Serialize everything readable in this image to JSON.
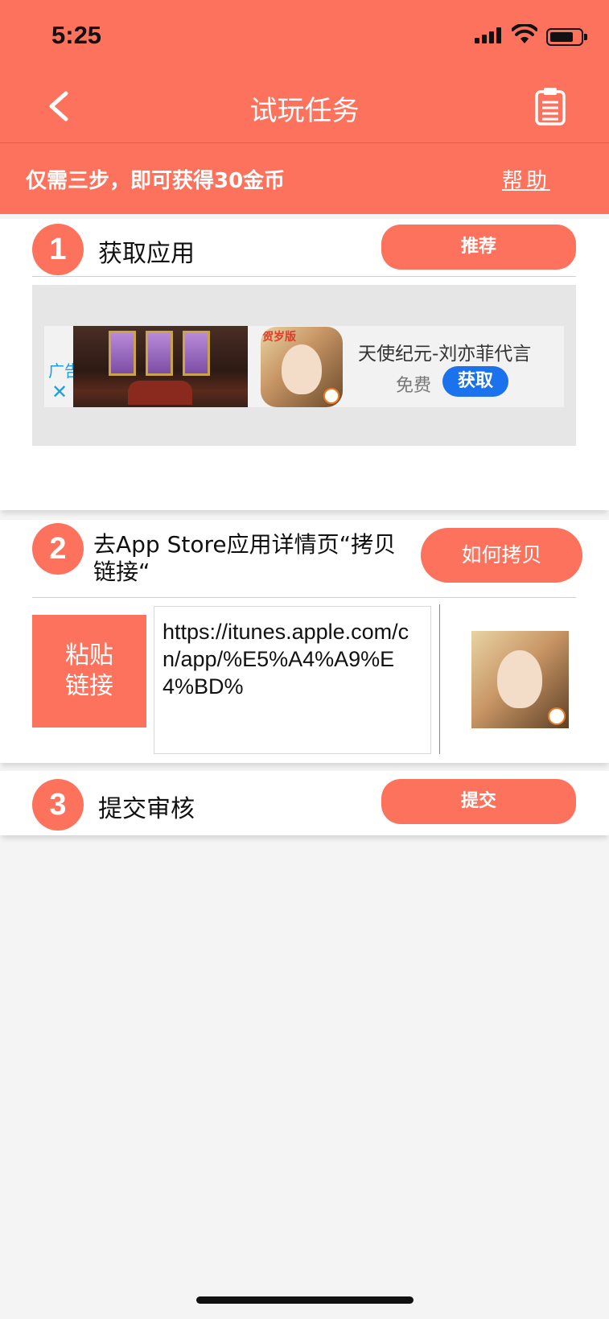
{
  "status_bar": {
    "time": "5:25"
  },
  "nav": {
    "title": "试玩任务"
  },
  "promo": {
    "text": "仅需三步，即可获得30金币",
    "help_label": "帮助"
  },
  "steps": [
    {
      "number": "1",
      "label": "获取应用",
      "button_label": "推荐",
      "ad": {
        "label": "广告",
        "app_name": "天使纪元-刘亦菲代言",
        "price_label": "免费",
        "get_label": "获取",
        "icon_tag": "贺岁版"
      }
    },
    {
      "number": "2",
      "label": "去App Store应用详情页“拷贝链接“",
      "button_label": "如何拷贝",
      "paste_label": "粘贴链接",
      "link_value": "https://itunes.apple.com/cn/app/%E5%A4%A9%E4%BD%"
    },
    {
      "number": "3",
      "label": "提交审核",
      "button_label": "提交"
    }
  ],
  "colors": {
    "accent": "#fd725c",
    "ad_button": "#1a73ec",
    "ad_label": "#1aa0e0"
  }
}
